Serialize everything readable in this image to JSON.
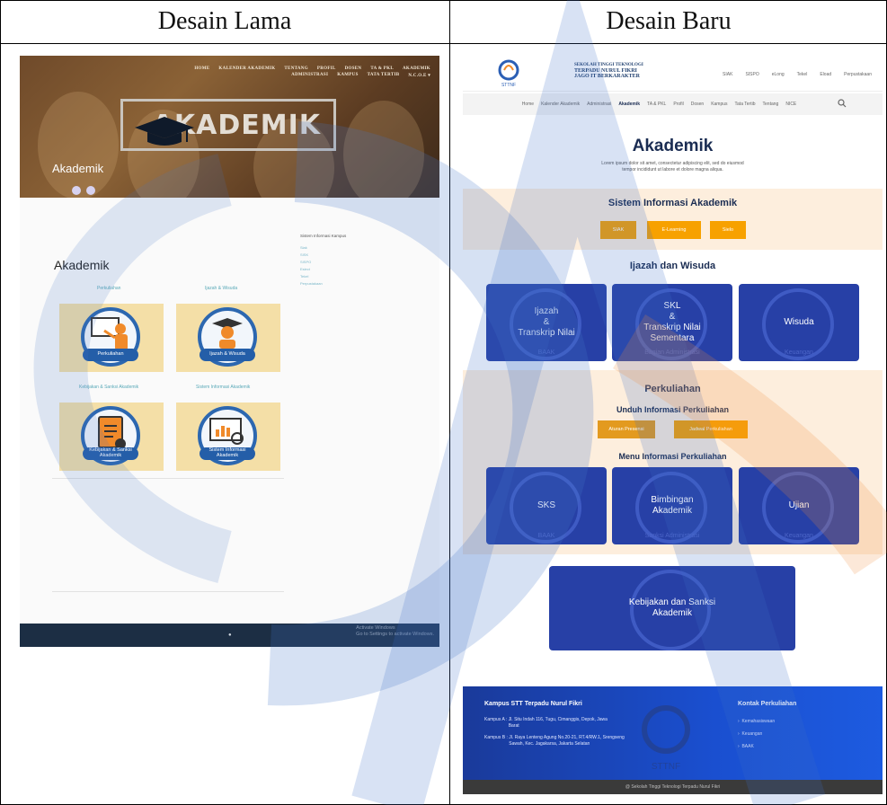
{
  "headers": {
    "left": "Desain Lama",
    "right": "Desain Baru"
  },
  "old": {
    "nav": [
      "HOME",
      "KALENDER AKADEMIK",
      "TENTANG",
      "PROFIL",
      "DOSEN",
      "TA & PKL",
      "AKADEMIK",
      "ADMINISTRASI",
      "KAMPUS",
      "TATA TERTIB",
      "N.C.O.E ▾"
    ],
    "banner": "AKADEMIK",
    "hero_title": "Akademik",
    "page_title": "Akademik",
    "sidebar_heading": "Sistem Informasi Kampus",
    "sidebar_items": [
      "Siak",
      "SISK",
      "SISPO",
      "Eslect",
      "Tekel",
      "Perpustakaan"
    ],
    "cards": [
      {
        "label": "Perkuliahan",
        "pill": "Perkuliahan"
      },
      {
        "label": "Ijazah & Wisuda",
        "pill": "Ijazah & Wisuda"
      },
      {
        "label": "Kebijakan & Sanksi Akademik",
        "pill": "Kebijakan & Sanksi Akademik"
      },
      {
        "label": "Sistem Informasi Akademik",
        "pill": "Sistem Informasi Akademik"
      }
    ],
    "activate_line1": "Activate Windows",
    "activate_line2": "Go to Settings to activate Windows."
  },
  "new": {
    "school_line1": "SEKOLAH TINGGI TEKNOLOGI",
    "school_line2": "TERPADU NURUL FIKRI",
    "school_line3": "JAGO IT BERKARAKTER",
    "top_links": [
      "SIAK",
      "SISPO",
      "eLong",
      "Tekel",
      "Eload",
      "Perpustakaan"
    ],
    "nav": [
      "Home",
      "Kalender Akademik",
      "Administrasi",
      "Akademik",
      "TA & PKL",
      "Profil",
      "Dosen",
      "Kampus",
      "Tata Tertib",
      "Tentang",
      "NICE"
    ],
    "title": "Akademik",
    "lorem": "Lorem ipsum dolor sit amet, consectetur adipiscing elit, sed do eiusmod tempor incididunt ut labore et dolore magna aliqua.",
    "sia_title": "Sistem Informasi Akademik",
    "sia_buttons": [
      "SIAK",
      "E-Learning",
      "Sielo"
    ],
    "ijazah_title": "Ijazah dan Wisuda",
    "ijazah_cards": [
      {
        "main": "Ijazah\n&\nTranskrip Nilai",
        "sub": "BAAK"
      },
      {
        "main": "SKL\n&\nTranskrip Nilai\nSementara",
        "sub": "Bagian Administrasi"
      },
      {
        "main": "Wisuda",
        "sub": "Keuangan"
      }
    ],
    "kuliah_title": "Perkuliahan",
    "unduh_title": "Unduh Informasi Perkuliahan",
    "unduh_buttons": [
      "Aturan Presensi",
      "Jadwal Perkuliahan"
    ],
    "menu_title": "Menu Informasi Perkuliahan",
    "menu_cards": [
      {
        "main": "SKS",
        "sub": "BAAK"
      },
      {
        "main": "Bimbingan\nAkademik",
        "sub": "Sanksi Administrasi"
      },
      {
        "main": "Ujian",
        "sub": "Keuangan"
      }
    ],
    "kebijakan": "Kebijakan dan Sanksi\nAkademik",
    "footer_campus_title": "Kampus STT Terpadu Nurul Fikri",
    "campus_a_label": "Kampus A :",
    "campus_a_addr": "Jl. Situ Indah 116, Tugu, Cimanggis, Depok, Jawa Barat",
    "campus_b_label": "Kampus B :",
    "campus_b_addr": "Jl. Raya Lenteng Agung No.20-21, RT.4/RW.1, Srengseng Sawah, Kec. Jagakarsa, Jakarta Selatan",
    "footer_contact_title": "Kontak Perkuliahan",
    "footer_links": [
      "Kemahasiswaan",
      "Keuangan",
      "BAAK"
    ],
    "copyright": "@ Sekolah Tinggi Teknologi Terpadu Nurul Fikri"
  }
}
